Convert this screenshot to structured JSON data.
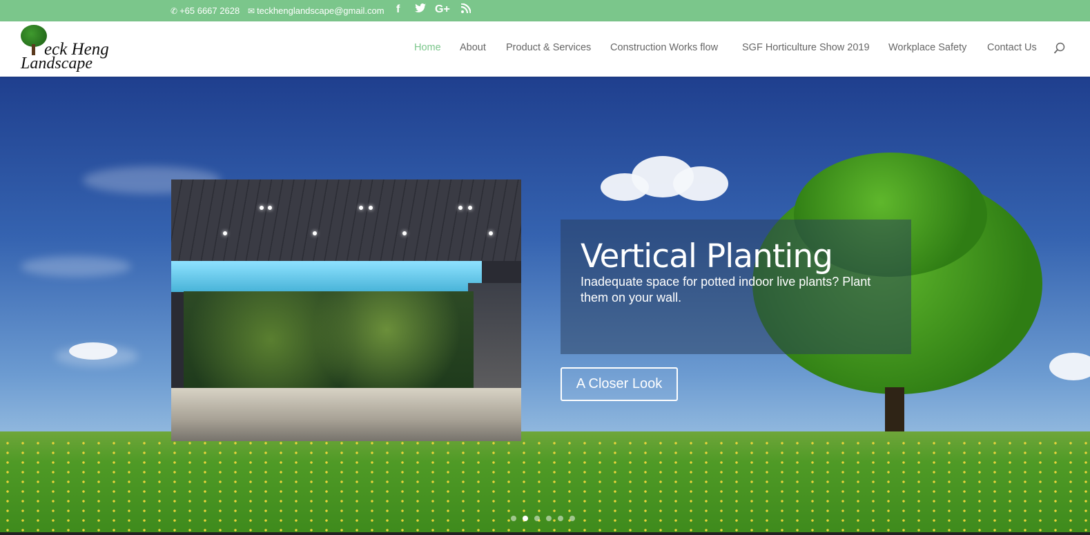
{
  "topbar": {
    "phone": "+65 6667 2628",
    "email": "teckhenglandscape@gmail.com",
    "social_icons": [
      "facebook-icon",
      "twitter-icon",
      "google-plus-icon",
      "rss-icon"
    ],
    "background_color": "#7bc68b"
  },
  "logo": {
    "line1": "eck Heng",
    "line2": "Landscape"
  },
  "nav": {
    "items": [
      {
        "label": "Home",
        "active": true
      },
      {
        "label": "About"
      },
      {
        "label": "Product & Services"
      },
      {
        "label": "Construction Works flow"
      },
      {
        "label": "SGF Horticulture Show 2019"
      },
      {
        "label": "Workplace Safety"
      },
      {
        "label": "Contact Us"
      }
    ],
    "active_color": "#7bc68b",
    "search_icon": "search-icon"
  },
  "slide": {
    "title": "Vertical Planting",
    "description": "Inadequate space for potted indoor live plants? Plant them on your wall.",
    "button_label": "A Closer Look",
    "dots_count": 6,
    "active_dot_index": 1
  }
}
